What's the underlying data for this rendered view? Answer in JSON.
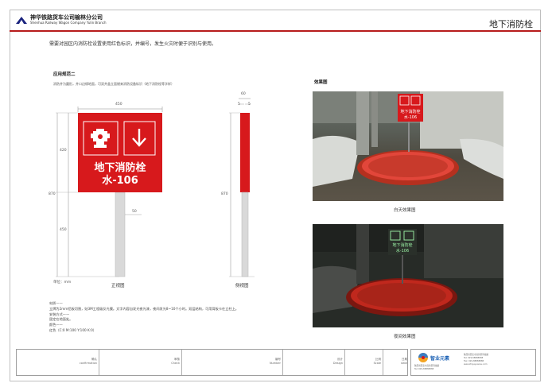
{
  "header": {
    "company_cn": "神华铁路货车公司榆林分公司",
    "company_en": "Shenhua Railway Wagon Company Yulin Branch",
    "page_title": "地下消防栓"
  },
  "intro": "需要对园区内消防栓设置使用红色标识，并编号，发生火灾时便于识别与使用。",
  "section": {
    "title": "应用规范二",
    "desc": "消防井为圆形，井口边缘地面，可双井盖立面燃来消防设备标识（地下消防栓等字样）"
  },
  "sign": {
    "line1": "地下消防栓",
    "line2": "水-106"
  },
  "dimensions": {
    "width": "450",
    "top": "420",
    "total": "870",
    "bottom": "450",
    "pole": "50",
    "side_total": "60",
    "side_a": "5",
    "side_b": "5",
    "side_height": "870"
  },
  "captions": {
    "front": "正视图",
    "side": "侧视图",
    "effect_title": "效果图",
    "day": "白天效果图",
    "night": "夜间效果图",
    "unit": "单位：mm"
  },
  "notes": [
    "材质——",
    "立牌为2mm铝板切割，贴3M工程级反光膜。文字内容自发光夜光漆，夜间发光8~10个小时。双层结构，可用背板卡在立柱上。",
    "安装方式——",
    "固定在地面处。",
    "颜色——",
    "红色（C:0 M:100 Y:100 K:0）"
  ],
  "footer": {
    "cells": [
      {
        "cn": "确认",
        "en": "confirmation"
      },
      {
        "cn": "审核",
        "en": "Check"
      },
      {
        "cn": "编号",
        "en": "Number"
      },
      {
        "cn": "设计",
        "en": "Design"
      },
      {
        "cn": "比例",
        "en": "Scale"
      },
      {
        "cn": "日期",
        "en": "date"
      }
    ],
    "brand": "智业元素",
    "info": [
      "陕西省西安市高新区科技路",
      "Tel: 029-88888888",
      "Fax: 029-88888888",
      "www.zhiyeyuansu.com"
    ]
  },
  "colors": {
    "brand_red": "#d7191c",
    "accent_line": "#b71c1c",
    "night_glow": "#9ef7a8"
  }
}
